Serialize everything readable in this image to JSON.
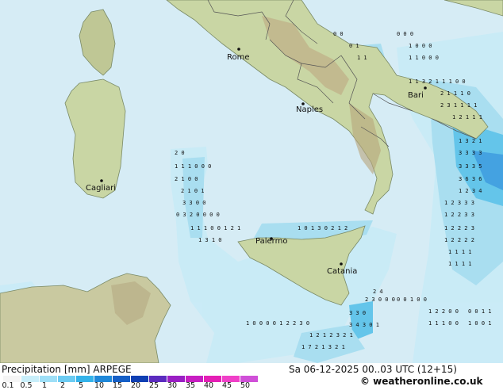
{
  "map": {
    "cities": [
      {
        "name": "Rome"
      },
      {
        "name": "Naples"
      },
      {
        "name": "Bari"
      },
      {
        "name": "Cagliari"
      },
      {
        "name": "Palermo"
      },
      {
        "name": "Catania"
      }
    ],
    "colors": {
      "sea": "#d6ecf5",
      "land": "#c9d6a4",
      "land_high": "#bfae86",
      "rain_light": "#a7def0",
      "rain_medium": "#5ec3ea",
      "rain_heavy": "#3d9fe0",
      "border": "#555555"
    },
    "precip_grid_values": [
      "0",
      "1",
      "2",
      "3",
      "5",
      "6"
    ]
  },
  "footer": {
    "title": "Precipitation [mm]  ARPEGE",
    "datetime": "Sa 06-12-2025 00..03 UTC (12+15)",
    "copyright": "© weatheronline.co.uk",
    "scale_labels": [
      "0.1",
      "0.5",
      "1",
      "2",
      "5",
      "10",
      "15",
      "20",
      "25",
      "30",
      "35",
      "40",
      "45",
      "50"
    ],
    "scale_colors": [
      "#f5f5f5",
      "#c8eefa",
      "#9edff7",
      "#6ccbf2",
      "#35b3ea",
      "#1f88d9",
      "#155fc7",
      "#0f3fb3",
      "#5b2bbf",
      "#9a1fc4",
      "#c81ec2",
      "#e51fb5",
      "#f040c8",
      "#d050d8"
    ]
  }
}
